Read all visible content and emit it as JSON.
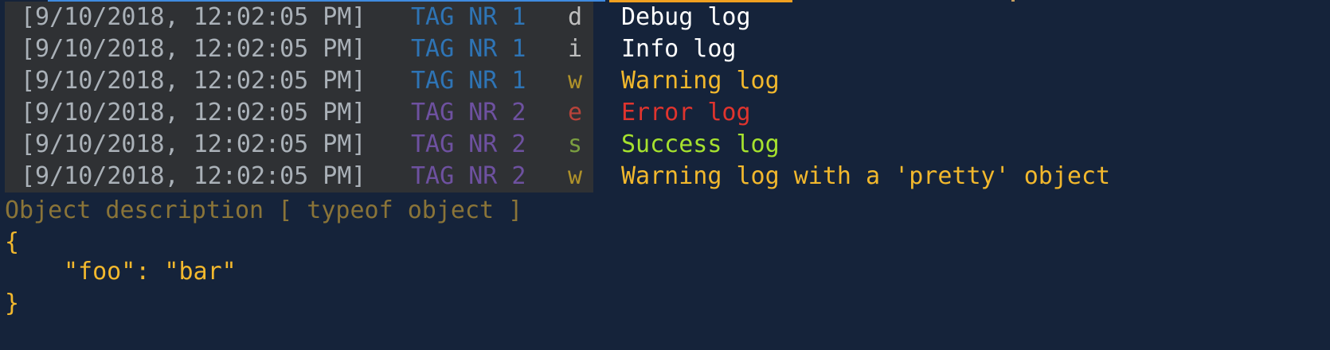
{
  "logs": [
    {
      "timestamp": "[9/10/2018, 12:02:05 PM]",
      "tag": "TAG NR 1",
      "level": "d",
      "message": "Debug log"
    },
    {
      "timestamp": "[9/10/2018, 12:02:05 PM]",
      "tag": "TAG NR 1",
      "level": "i",
      "message": "Info log"
    },
    {
      "timestamp": "[9/10/2018, 12:02:05 PM]",
      "tag": "TAG NR 1",
      "level": "w",
      "message": "Warning log"
    },
    {
      "timestamp": "[9/10/2018, 12:02:05 PM]",
      "tag": "TAG NR 2",
      "level": "e",
      "message": "Error log"
    },
    {
      "timestamp": "[9/10/2018, 12:02:05 PM]",
      "tag": "TAG NR 2",
      "level": "s",
      "message": "Success log"
    },
    {
      "timestamp": "[9/10/2018, 12:02:05 PM]",
      "tag": "TAG NR 2",
      "level": "w",
      "message": "Warning log with a 'pretty' object"
    }
  ],
  "object_output": {
    "description": "Object description [ typeof object ]",
    "open_brace": "{",
    "line": "\"foo\": \"bar\"",
    "close_brace": "}"
  },
  "colors": {
    "background": "#15233a",
    "prefix_background": "#2f3134",
    "tag1": "#2e74b5",
    "tag2": "#6e51a0",
    "warning": "#f2b82d",
    "error": "#e0342e",
    "success": "#a6e22e"
  }
}
